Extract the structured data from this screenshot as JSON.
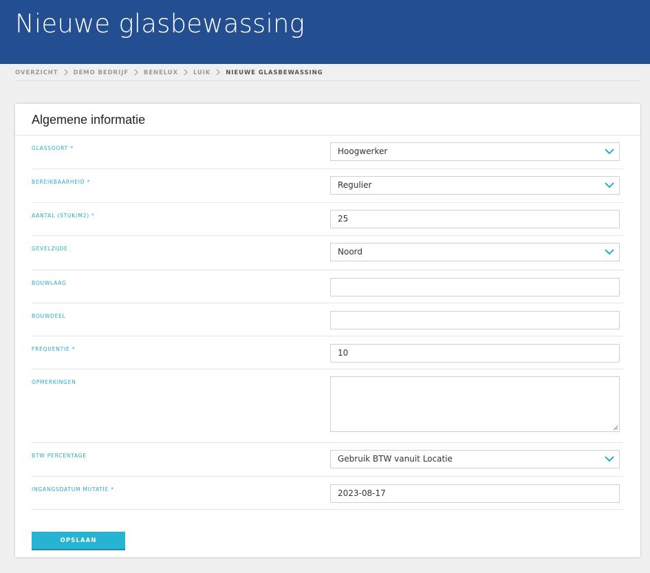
{
  "header": {
    "title": "Nieuwe glasbewassing"
  },
  "breadcrumb": [
    "OVERZICHT",
    "DEMO BEDRIJF",
    "BENELUX",
    "LUIK",
    "NIEUWE GLASBEWASSING"
  ],
  "card": {
    "title": "Algemene informatie"
  },
  "form": {
    "glassoort": {
      "label": "GLASSOORT *",
      "value": "Hoogwerker"
    },
    "bereikbaarheid": {
      "label": "BEREIKBAARHEID *",
      "value": "Regulier"
    },
    "aantal": {
      "label": "AANTAL (STUK/M2) *",
      "value": "25"
    },
    "gevelzijde": {
      "label": "GEVELZIJDE",
      "value": "Noord"
    },
    "bouwlaag": {
      "label": "BOUWLAAG",
      "value": ""
    },
    "bouwdeel": {
      "label": "BOUWDEEL",
      "value": ""
    },
    "frequentie": {
      "label": "FREQUENTIE *",
      "value": "10"
    },
    "opmerkingen": {
      "label": "OPMERKINGEN",
      "value": ""
    },
    "btw": {
      "label": "BTW PERCENTAGE",
      "value": "Gebruik BTW vanuit Locatie"
    },
    "ingangsdatum": {
      "label": "INGANGSDATUM MUTATIE *",
      "value": "2023-08-17"
    }
  },
  "actions": {
    "save_label": "OPSLAAN"
  },
  "colors": {
    "header_bg": "#234e8f",
    "accent": "#27b3d2",
    "label": "#27a9c9"
  },
  "icons": {
    "dropdown": "chevron-down-icon",
    "separator": "chevron-right-icon"
  }
}
